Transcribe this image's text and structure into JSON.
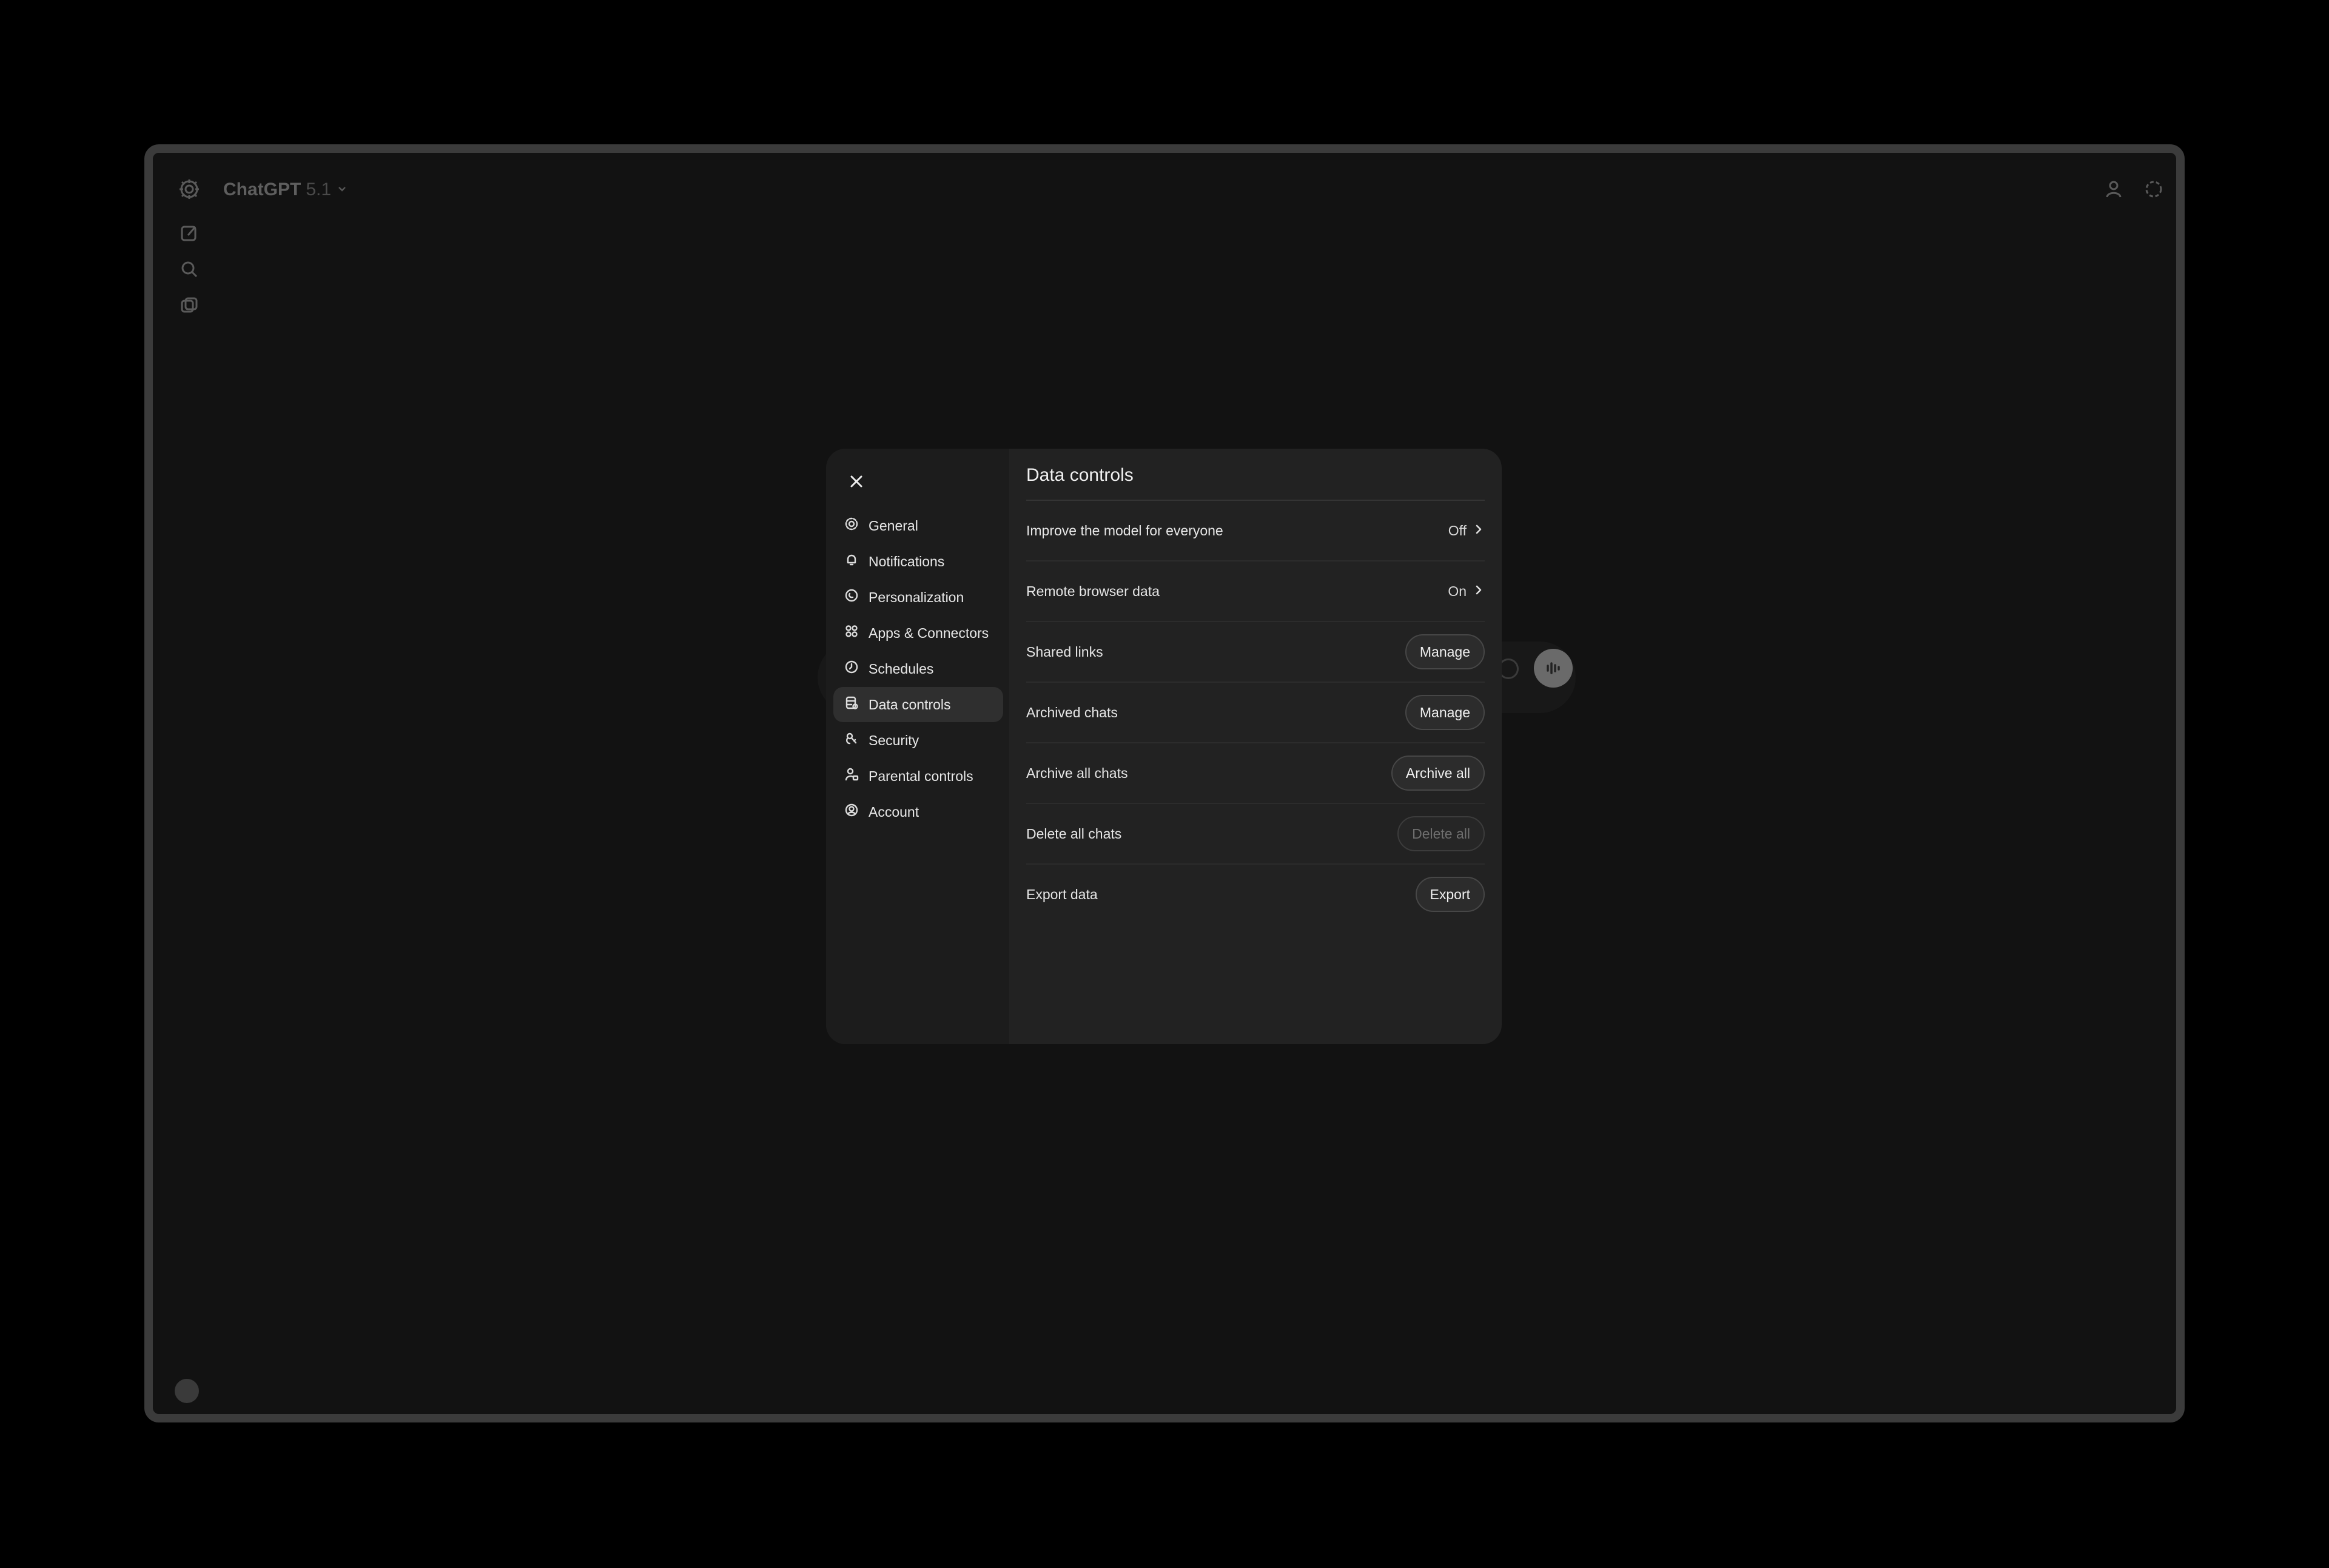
{
  "app": {
    "model_name": "ChatGPT",
    "model_version": "5.1"
  },
  "icons": {
    "logo": "openai-logo-icon",
    "new_chat": "new-chat-icon",
    "search": "search-icon",
    "library": "library-icon",
    "share": "person-icon",
    "temporary": "temporary-chat-icon"
  },
  "settings_nav": [
    {
      "label": "General",
      "icon": "gear-icon"
    },
    {
      "label": "Notifications",
      "icon": "bell-icon"
    },
    {
      "label": "Personalization",
      "icon": "personalization-icon"
    },
    {
      "label": "Apps & Connectors",
      "icon": "apps-icon"
    },
    {
      "label": "Schedules",
      "icon": "clock-icon"
    },
    {
      "label": "Data controls",
      "icon": "database-icon",
      "active": true
    },
    {
      "label": "Security",
      "icon": "security-icon"
    },
    {
      "label": "Parental controls",
      "icon": "parental-icon"
    },
    {
      "label": "Account",
      "icon": "account-icon"
    }
  ],
  "panel": {
    "title": "Data controls",
    "rows": [
      {
        "label": "Improve the model for everyone",
        "value": "Off",
        "kind": "chevron"
      },
      {
        "label": "Remote browser data",
        "value": "On",
        "kind": "chevron"
      },
      {
        "label": "Shared links",
        "button": "Manage",
        "kind": "button"
      },
      {
        "label": "Archived chats",
        "button": "Manage",
        "kind": "button"
      },
      {
        "label": "Archive all chats",
        "button": "Archive all",
        "kind": "button"
      },
      {
        "label": "Delete all chats",
        "button": "Delete all",
        "kind": "button",
        "disabled": true
      },
      {
        "label": "Export data",
        "button": "Export",
        "kind": "button"
      }
    ]
  }
}
